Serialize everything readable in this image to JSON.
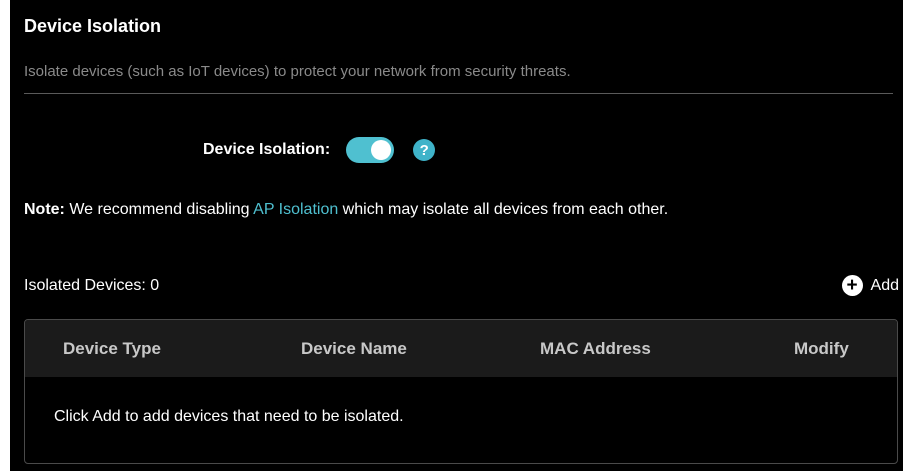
{
  "colors": {
    "accent": "#4fc0d0",
    "help": "#3fb3c9"
  },
  "section": {
    "title": "Device Isolation",
    "description": "Isolate devices (such as IoT devices) to protect your network from security threats."
  },
  "isolation": {
    "label": "Device Isolation:",
    "toggle_state": "on",
    "help_icon": "question-mark-icon",
    "help_glyph": "?"
  },
  "note": {
    "prefix": "Note:",
    "text_before": " We recommend disabling ",
    "link": "AP Isolation",
    "text_after": " which may isolate all devices from each other."
  },
  "devices": {
    "count_label": "Isolated Devices: 0",
    "add_label": "Add",
    "add_icon": "plus-circle-icon",
    "add_glyph": "+"
  },
  "table": {
    "columns": [
      "Device Type",
      "Device Name",
      "MAC Address",
      "Modify"
    ],
    "empty_message": "Click Add to add devices that need to be isolated."
  }
}
